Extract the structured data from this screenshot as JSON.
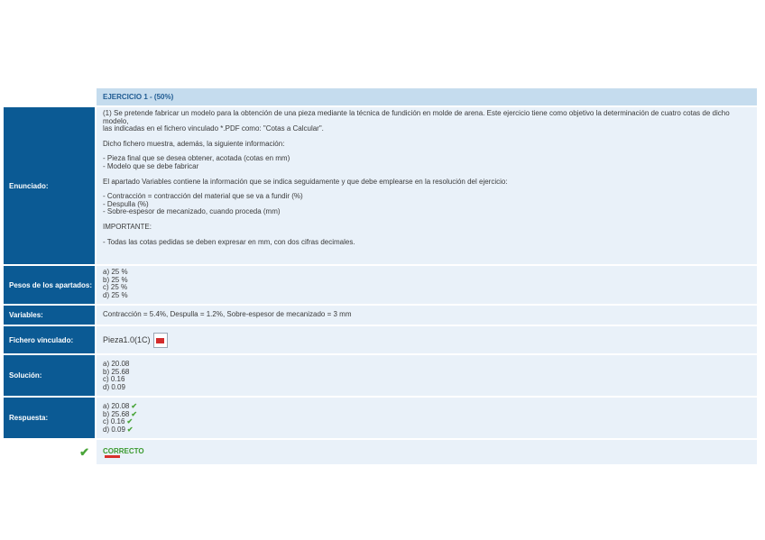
{
  "header": {
    "title": "EJERCICIO 1 - (50%)"
  },
  "enunciado": {
    "label": "Enunciado:",
    "paragraph1_line1": "(1) Se pretende fabricar un modelo para la obtención de una pieza mediante la técnica de fundición en molde de arena. Este ejercicio tiene como objetivo la determinación de cuatro cotas de dicho modelo,",
    "paragraph1_line2": "las indicadas en el fichero vinculado *.PDF como: \"Cotas a Calcular\".",
    "paragraph2": "Dicho fichero muestra, además, la siguiente información:",
    "list1": [
      "- Pieza final que se desea obtener, acotada (cotas en mm)",
      "- Modelo que se debe fabricar"
    ],
    "paragraph3": "El apartado Variables contiene la información que se indica seguidamente y que debe emplearse en la resolución del ejercicio:",
    "list2": [
      "- Contracción = contracción del material que se va a fundir (%)",
      "- Despulla (%)",
      "- Sobre-espesor de mecanizado, cuando proceda (mm)"
    ],
    "important": "IMPORTANTE:",
    "note": "- Todas las cotas pedidas se deben expresar en mm, con dos cifras decimales."
  },
  "pesos": {
    "label": "Pesos de los apartados:",
    "items": [
      "a) 25 %",
      "b) 25 %",
      "c) 25 %",
      "d) 25 %"
    ]
  },
  "variables": {
    "label": "Variables:",
    "text": "Contracción = 5.4%, Despulla = 1.2%, Sobre-espesor de mecanizado = 3 mm"
  },
  "fichero": {
    "label": "Fichero vinculado:",
    "text": "Pieza1.0(1C)",
    "icon": "pdf-file-icon"
  },
  "solucion": {
    "label": "Solución:",
    "items": [
      "a) 20.08",
      "b) 25.68",
      "c) 0.16",
      "d) 0.09"
    ]
  },
  "respuesta": {
    "label": "Respuesta:",
    "items": [
      "a) 20.08",
      "b) 25.68",
      "c) 0.16",
      "d) 0.09"
    ],
    "check_symbol": "✔"
  },
  "result": {
    "check_symbol": "✔",
    "text": "CORRECTO"
  },
  "colors": {
    "label_bg": "#0b5a94",
    "content_bg": "#e9f1f9",
    "header_bg": "#c5dcee",
    "correct_green": "#3a9a2e"
  }
}
